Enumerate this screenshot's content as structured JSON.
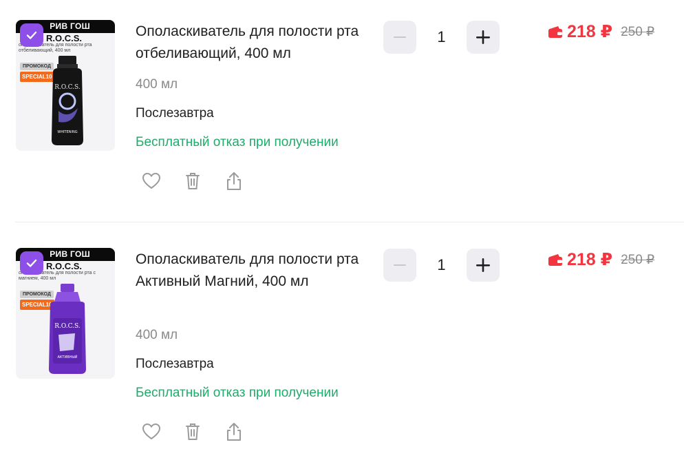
{
  "colors": {
    "accent_purple": "#8e4ee8",
    "price_red": "#f2353f",
    "refund_green": "#1fab6a",
    "promo_orange": "#f26a1b"
  },
  "items": [
    {
      "image": {
        "brand": "РИВ ГОШ",
        "title": "R.O.C.S.",
        "subtitle": "ополаскиватель для полости рта отбеливающий, 400 мл",
        "promo_label": "ПРОМОКОД",
        "promo_code": "SPECIAL10",
        "bottle_logo": "R.O.C.S.",
        "bottle_text": "WHITENING"
      },
      "name": "Ополаскиватель для полости рта отбеливающий, 400 мл",
      "volume": "400 мл",
      "delivery": "Послезавтра",
      "refund": "Бесплатный отказ при получении",
      "quantity": "1",
      "price": "218 ₽",
      "old_price": "250 ₽",
      "icons": [
        "checkbox-icon",
        "heart-icon",
        "trash-icon",
        "share-icon",
        "minus-icon",
        "plus-icon",
        "wallet-icon"
      ]
    },
    {
      "image": {
        "brand": "РИВ ГОШ",
        "title": "R.O.C.S.",
        "subtitle": "ополаскиватель для полости рта с магнием, 400 мл",
        "promo_label": "ПРОМОКОД",
        "promo_code": "SPECIAL10",
        "bottle_logo": "R.O.C.S.",
        "bottle_text": "АКТИВНЫЙ"
      },
      "name": "Ополаскиватель для полости рта Активный Магний, 400 мл",
      "volume": "400 мл",
      "delivery": "Послезавтра",
      "refund": "Бесплатный отказ при получении",
      "quantity": "1",
      "price": "218 ₽",
      "old_price": "250 ₽",
      "icons": [
        "checkbox-icon",
        "heart-icon",
        "trash-icon",
        "share-icon",
        "minus-icon",
        "plus-icon",
        "wallet-icon"
      ]
    }
  ]
}
